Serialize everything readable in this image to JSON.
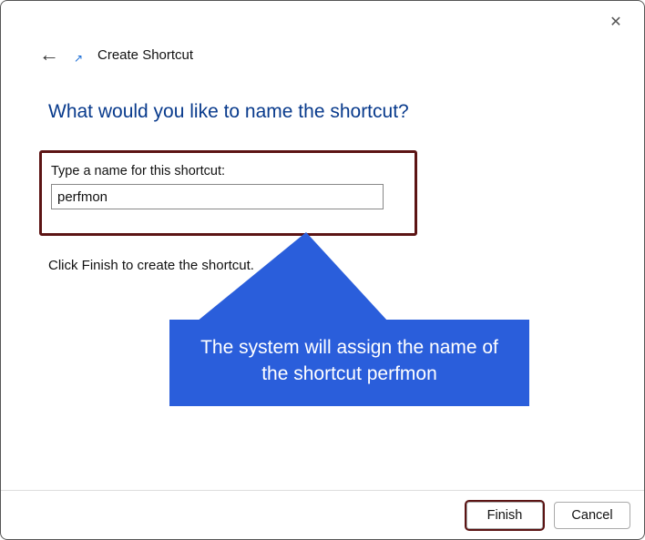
{
  "titlebar": {
    "close_glyph": "✕"
  },
  "header": {
    "back_glyph": "←",
    "shortcut_icon_glyph": "↗",
    "title": "Create Shortcut"
  },
  "main": {
    "question": "What would you like to name the shortcut?",
    "field_label": "Type a name for this shortcut:",
    "field_value": "perfmon",
    "instruction": "Click Finish to create the shortcut."
  },
  "callout": {
    "text": "The system will assign the name of the shortcut perfmon",
    "color": "#2a5edb"
  },
  "footer": {
    "finish_label": "Finish",
    "cancel_label": "Cancel"
  },
  "highlight_color": "#5c1414"
}
